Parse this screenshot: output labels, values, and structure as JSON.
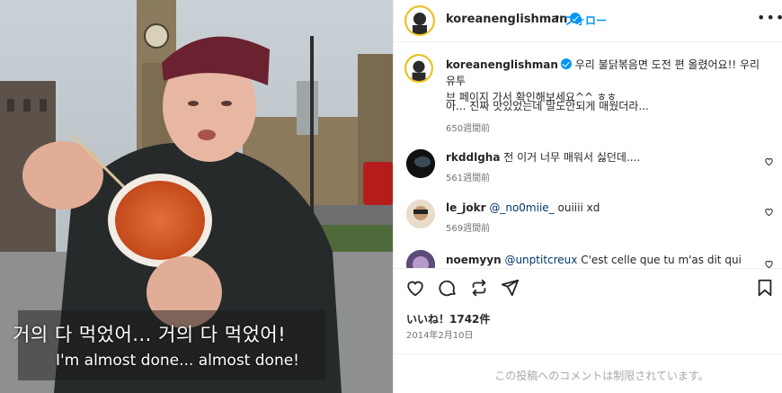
{
  "media": {
    "subtitle_korean": "거의 다 먹었어... 거의 다 먹었어!",
    "subtitle_english": "I'm almost done... almost done!"
  },
  "header": {
    "username": "koreanenglishman",
    "separator": "•",
    "follow_label": "フォロー",
    "more_label": "•••"
  },
  "caption": {
    "username": "koreanenglishman",
    "text_line1": "우리 불닭볶음면 도전 편 올렸어요!! 우리 유투",
    "text_line2": "브 페이지 가서 확인해보세요^^ ㅎㅎ",
    "text_line3": "아... 진짜 맛있었는데 말도안되게 매웠더라...",
    "time": "650週間前"
  },
  "comments": [
    {
      "username": "rkddlgha",
      "mention": "",
      "text": "전 이거 너무 매워서 싫던데....",
      "time": "561週間前"
    },
    {
      "username": "le_jokr",
      "mention": "@_no0miie_",
      "text": "ouiiii xd",
      "time": "569週間前"
    },
    {
      "username": "noemyyn",
      "mention": "@unptitcreux",
      "text": "C'est celle que tu m'as dit qui sont",
      "time": ""
    }
  ],
  "actions": {
    "likes": "いいね！1742件",
    "date": "2014年2月10日"
  },
  "footer": {
    "text": "この投稿へのコメントは制限されています。"
  },
  "colors": {
    "accent": "#0095f6",
    "text": "#262626",
    "muted": "#737373"
  }
}
